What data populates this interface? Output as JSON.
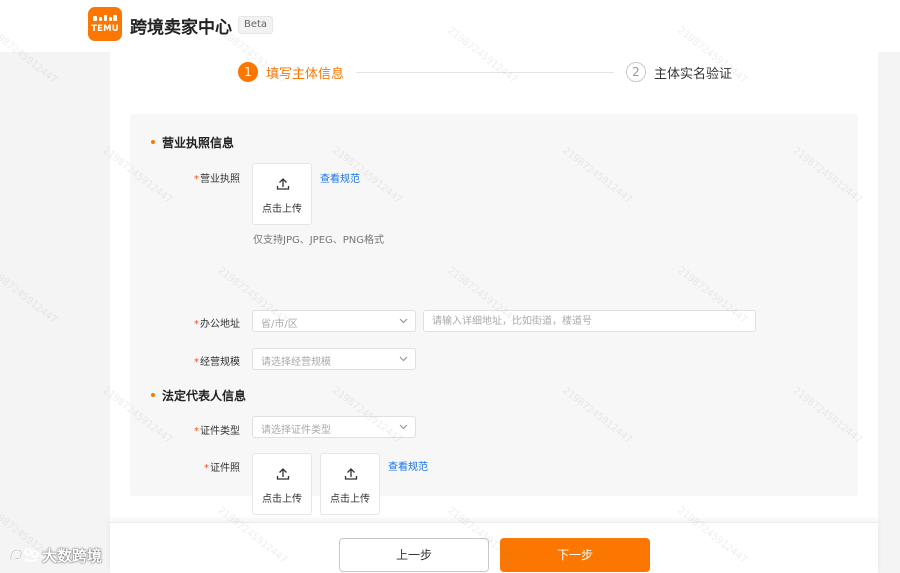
{
  "header": {
    "logo_text": "TEMU",
    "app_title": "跨境卖家中心",
    "badge": "Beta"
  },
  "steps": [
    {
      "number": "1",
      "label": "填写主体信息",
      "status": "active"
    },
    {
      "number": "2",
      "label": "主体实名验证",
      "status": "pending"
    }
  ],
  "sections": {
    "license": {
      "title": "营业执照信息"
    },
    "legal_rep": {
      "title": "法定代表人信息"
    }
  },
  "fields": {
    "business_license": {
      "required_mark": "*",
      "label": "营业执照",
      "upload_text": "点击上传",
      "guide_link": "查看规范",
      "hint": "仅支持JPG、JPEG、PNG格式"
    },
    "office_address": {
      "required_mark": "*",
      "label": "办公地址",
      "region_placeholder": "省/市/区",
      "detail_placeholder": "请输入详细地址，比如街道，楼道号"
    },
    "business_scale": {
      "required_mark": "*",
      "label": "经营规模",
      "placeholder": "请选择经营规模"
    },
    "id_type": {
      "required_mark": "*",
      "label": "证件类型",
      "placeholder": "请选择证件类型"
    },
    "id_photo": {
      "required_mark": "*",
      "label": "证件照",
      "upload_front_text": "点击上传",
      "upload_back_text": "点击上传",
      "guide_link": "查看规范"
    }
  },
  "footer": {
    "prev_label": "上一步",
    "next_label": "下一步"
  },
  "watermark": {
    "text": "21987245912447",
    "brand_text": "大数跨境"
  },
  "colors": {
    "accent": "#fb7701",
    "link": "#1a73e8",
    "required": "#f04c25",
    "panel_bg": "#f7f7f7"
  },
  "icons": [
    "upload-icon",
    "chevron-down-icon",
    "temu-logo-icon",
    "brand-icon"
  ]
}
